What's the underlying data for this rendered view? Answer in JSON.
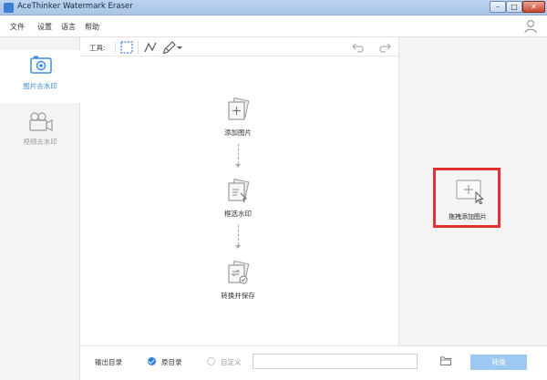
{
  "window": {
    "title": "AceThinker Watermark Eraser",
    "controls": {
      "minimize": "–",
      "maximize": "□",
      "close": "✕"
    }
  },
  "menu": {
    "items": [
      "文件",
      "设置",
      "语言",
      "帮助"
    ]
  },
  "sidebar": {
    "items": [
      {
        "label": "图片去水印",
        "icon": "image-icon",
        "active": true
      },
      {
        "label": "视频去水印",
        "icon": "video-camera-icon",
        "active": false
      }
    ]
  },
  "toolbar": {
    "label": "工具:",
    "tools": [
      "rectangle-select-icon",
      "polyline-icon",
      "brush-icon"
    ],
    "undo_icon": "undo-icon",
    "redo_icon": "redo-icon"
  },
  "steps": [
    {
      "label": "添加图片",
      "icon": "add-image-icon"
    },
    {
      "label": "框选水印",
      "icon": "select-watermark-icon"
    },
    {
      "label": "转换并保存",
      "icon": "convert-save-icon"
    }
  ],
  "drop_zone": {
    "label": "拖拽添加图片",
    "icon": "add-image-cursor-icon",
    "highlight_color": "#e23131"
  },
  "bottom": {
    "output_label": "输出目录",
    "radio_source": {
      "label": "原目录",
      "selected": true
    },
    "radio_custom": {
      "label": "自定义",
      "selected": false
    },
    "path_value": "",
    "folder_icon": "folder-icon",
    "convert_label": "转换"
  },
  "colors": {
    "accent": "#2f7fe0",
    "convert_button": "#9cc8f2",
    "sidebar_icon": "#3b8fe0"
  }
}
